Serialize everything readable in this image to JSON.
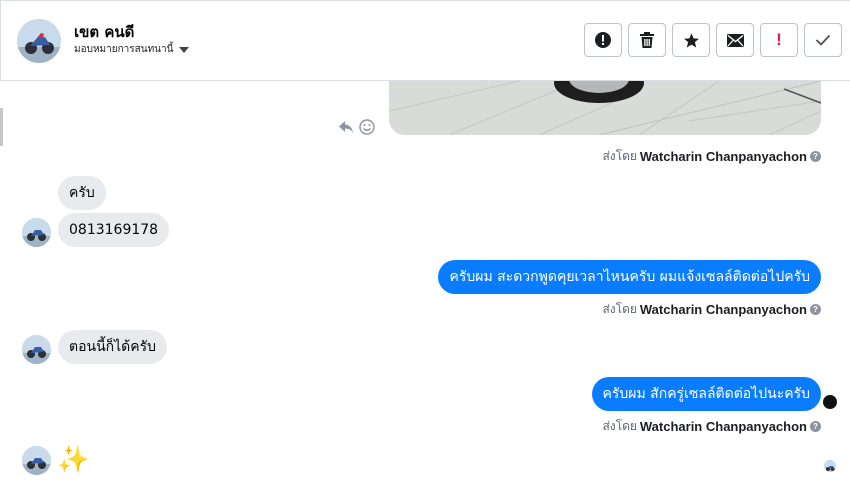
{
  "header": {
    "contact_name": "เขต คนดี",
    "assign_label": "มอบหมายการสนทนานี้",
    "actions": [
      {
        "name": "report-spam-button",
        "icon": "exclamation-circle-icon"
      },
      {
        "name": "delete-button",
        "icon": "trash-icon"
      },
      {
        "name": "star-button",
        "icon": "star-icon"
      },
      {
        "name": "mark-unread-button",
        "icon": "envelope-icon"
      },
      {
        "name": "mark-important-button",
        "icon": "red-exclamation-icon",
        "label": "!"
      },
      {
        "name": "mark-done-button",
        "icon": "checkmark-icon"
      }
    ]
  },
  "colors": {
    "outgoing_bubble": "#0a7cff",
    "incoming_bubble": "#e9eaed",
    "important_red": "#e41e3f"
  },
  "messages": [
    {
      "direction": "out",
      "type": "image",
      "sent_by_prefix": "ส่งโดย",
      "sent_by_name": "Watcharin Chanpanyachon"
    },
    {
      "direction": "in",
      "type": "text",
      "text": "ครับ"
    },
    {
      "direction": "in",
      "type": "text",
      "text": "0813169178"
    },
    {
      "direction": "out",
      "type": "text",
      "text": "ครับผม สะดวกพูดคุยเวลาไหนครับ ผมแจ้งเซลล์ติดต่อไปครับ",
      "sent_by_prefix": "ส่งโดย",
      "sent_by_name": "Watcharin Chanpanyachon"
    },
    {
      "direction": "in",
      "type": "text",
      "text": "ตอนนี้ก็ได้ครับ"
    },
    {
      "direction": "out",
      "type": "text",
      "text": "ครับผม สักครู่เซลล์ติดต่อไปนะครับ",
      "sent_by_prefix": "ส่งโดย",
      "sent_by_name": "Watcharin Chanpanyachon"
    },
    {
      "direction": "in",
      "type": "emoji",
      "text": "✨"
    }
  ]
}
